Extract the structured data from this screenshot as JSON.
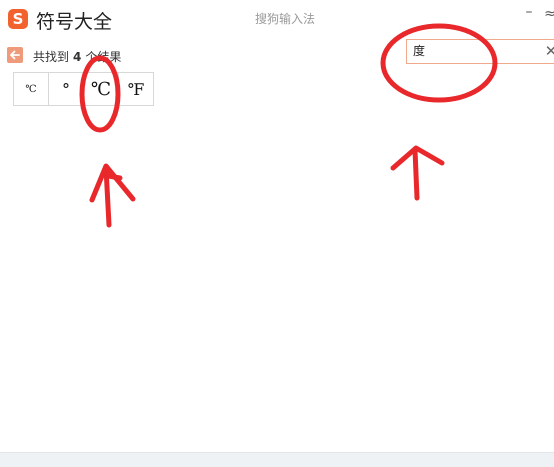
{
  "window": {
    "logo_letter": "S",
    "app_title": "符号大全",
    "ime_title": "搜狗输入法",
    "minimize_label": "–",
    "maximize_label": "≈"
  },
  "results": {
    "prefix": "共找到",
    "count": "4",
    "suffix": "个结果"
  },
  "search": {
    "value": "度",
    "clear_label": "✕"
  },
  "symbols": [
    "℃",
    "°",
    "℃",
    "℉"
  ],
  "colors": {
    "brand": "#f2622e",
    "annotation": "#e8282b",
    "search_border": "#f1a98d"
  }
}
